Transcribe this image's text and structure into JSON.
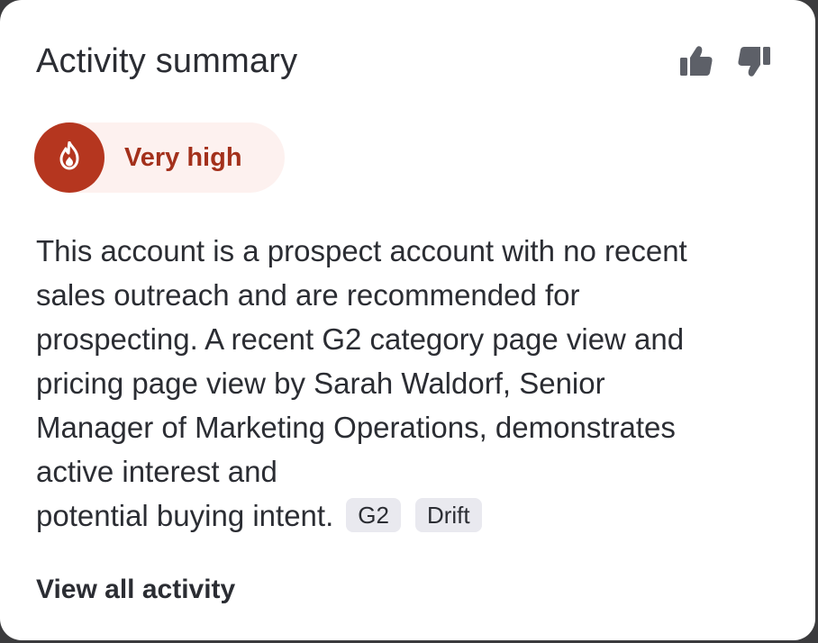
{
  "card": {
    "title": "Activity summary",
    "feedback": {
      "thumbs_up_icon": "thumbs-up-icon",
      "thumbs_down_icon": "thumbs-down-icon",
      "icon_color": "#5d6068"
    },
    "intent_badge": {
      "label": "Very high",
      "icon": "flame-icon",
      "accent_color": "#b5361f",
      "background_color": "#fdf1ef"
    },
    "summary_lines": [
      "This account is a prospect account with no recent",
      "sales outreach and are recommended for",
      "prospecting. A recent G2 category page view and",
      "pricing page view by Sarah Waldorf, Senior",
      "Manager of Marketing Operations, demonstrates",
      "active interest and",
      "potential buying intent."
    ],
    "source_tags": [
      "G2",
      "Drift"
    ],
    "view_all_label": "View all activity"
  }
}
